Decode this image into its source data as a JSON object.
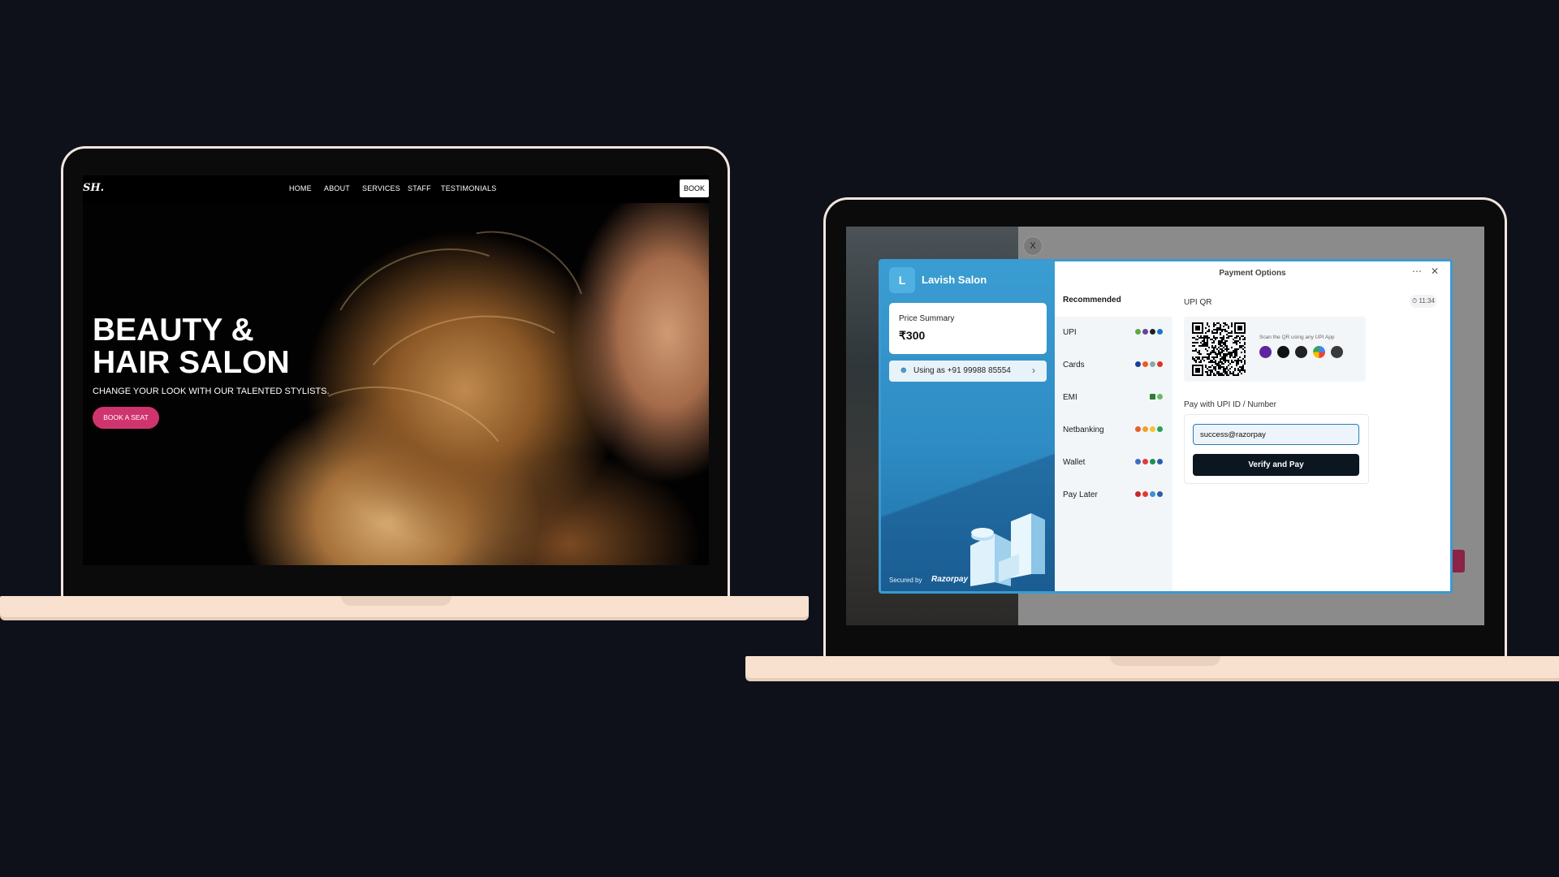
{
  "salon_site": {
    "logo": "SH.",
    "nav": [
      "HOME",
      "ABOUT",
      "SERVICES",
      "STAFF",
      "TESTIMONIALS"
    ],
    "book_label": "BOOK",
    "hero_title": "BEAUTY &\nHAIR SALON",
    "hero_subtitle": "CHANGE YOUR LOOK WITH OUR TALENTED STYLISTS.",
    "hero_cta": "BOOK A SEAT"
  },
  "background_page": {
    "close_label": "X"
  },
  "checkout": {
    "merchant_initial": "L",
    "merchant_name": "Lavish Salon",
    "price_summary_label": "Price Summary",
    "price_value": "₹300",
    "using_as": "Using as +91 99988 85554",
    "secured_by": "Secured by",
    "secured_brand": "Razorpay",
    "header_title": "Payment Options",
    "methods": [
      {
        "label": "Recommended",
        "active": true
      },
      {
        "label": "UPI"
      },
      {
        "label": "Cards"
      },
      {
        "label": "EMI"
      },
      {
        "label": "Netbanking"
      },
      {
        "label": "Wallet"
      },
      {
        "label": "Pay Later"
      }
    ],
    "upi_qr_label": "UPI QR",
    "timer": "11:34",
    "qr_hint": "Scan the QR using any UPI App",
    "upi_id_label": "Pay with UPI ID / Number",
    "upi_input_value": "success@razorpay",
    "verify_button": "Verify and Pay",
    "colors": {
      "merchant_blue": "#3a9dd2",
      "cta_pink": "#d0346f",
      "verify_dark": "#0b1620"
    }
  }
}
